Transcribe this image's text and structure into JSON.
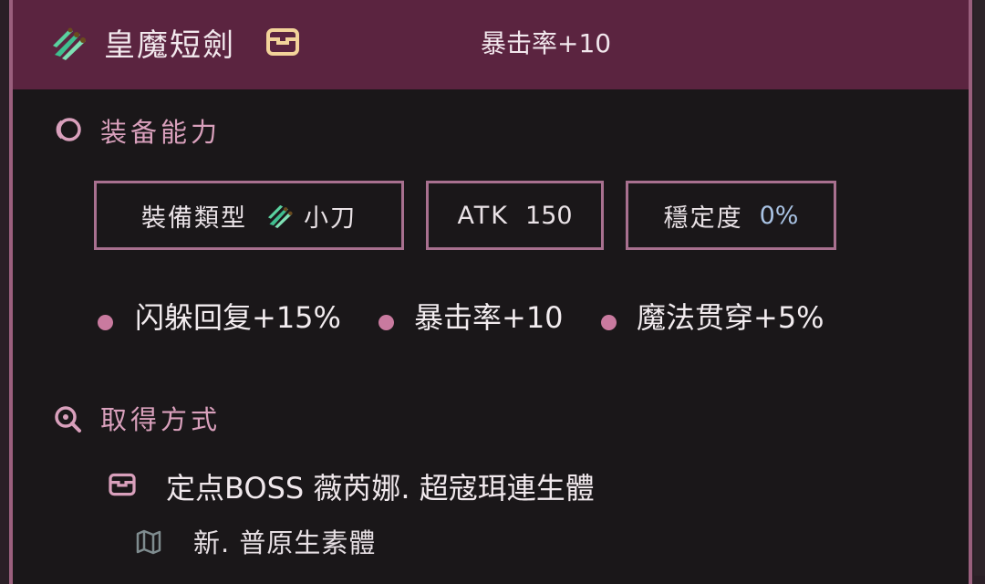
{
  "header": {
    "item_icon": "dagger-icon",
    "item_name": "皇魔短劍",
    "source_icon": "chest-icon",
    "stat": "暴击率+10"
  },
  "abilities": {
    "icon": "ring-icon",
    "title": "装备能力",
    "stats": [
      {
        "label": "裝備類型",
        "icon": "dagger-icon",
        "value": "小刀"
      },
      {
        "label": "ATK",
        "value": "150"
      },
      {
        "label": "穩定度",
        "value": "0%"
      }
    ],
    "bonuses": [
      "闪躲回复+15%",
      "暴击率+10",
      "魔法贯穿+5%"
    ]
  },
  "acquisition": {
    "icon": "search-icon",
    "title": "取得方式",
    "source_icon": "chest-icon",
    "source": "定点BOSS 薇芮娜. 超寇珥連生體",
    "map_icon": "map-icon",
    "map": "新. 普原生素體"
  },
  "colors": {
    "header_bg": "#5b2440",
    "card_bg": "#1a1719",
    "accent": "#c97a9f",
    "border": "#a8708f",
    "value_blue": "#a9c3e4"
  }
}
